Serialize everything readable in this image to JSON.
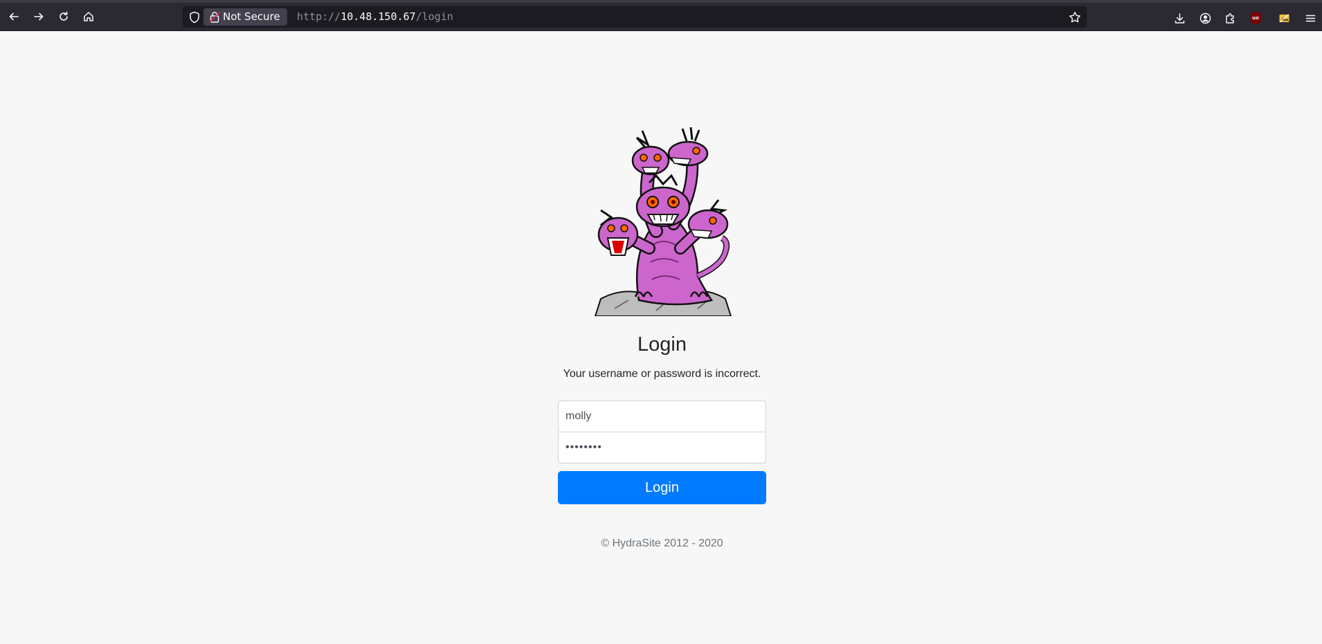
{
  "browser": {
    "security_label": "Not Secure",
    "url_scheme": "http://",
    "url_host": "10.48.150.67",
    "url_path": "/login",
    "icons": [
      "back-arrow-icon",
      "forward-arrow-icon",
      "reload-icon",
      "home-icon",
      "shield-icon",
      "lock-icon",
      "bookmark-star-icon",
      "download-icon",
      "account-icon",
      "extensions-icon",
      "ublock-icon",
      "screenshot-icon",
      "menu-icon"
    ]
  },
  "login": {
    "title": "Login",
    "error_message": "Your username or password is incorrect.",
    "username_value": "molly",
    "password_value": "••••••••",
    "button_label": "Login",
    "footer": "© HydraSite 2012 - 2020"
  },
  "colors": {
    "primary": "#007bff",
    "page_bg": "#f7f7f7",
    "hydra_purple": "#cc66cc"
  }
}
